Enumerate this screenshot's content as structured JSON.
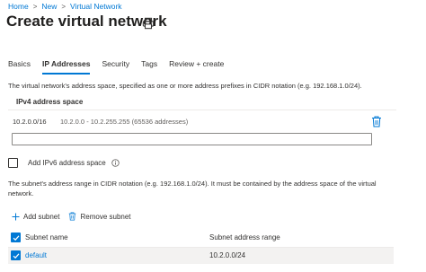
{
  "breadcrumb": {
    "items": [
      "Home",
      "New",
      "Virtual Network"
    ],
    "separator": ">"
  },
  "page": {
    "title": "Create virtual network"
  },
  "tabs": [
    {
      "label": "Basics",
      "active": false
    },
    {
      "label": "IP Addresses",
      "active": true
    },
    {
      "label": "Security",
      "active": false
    },
    {
      "label": "Tags",
      "active": false
    },
    {
      "label": "Review + create",
      "active": false
    }
  ],
  "address_space": {
    "description": "The virtual network's address space, specified as one or more address prefixes in CIDR notation (e.g. 192.168.1.0/24).",
    "header": "IPv4 address space",
    "rows": [
      {
        "prefix": "10.2.0.0/16",
        "range": "10.2.0.0 - 10.2.255.255 (65536 addresses)"
      }
    ],
    "new_input_value": ""
  },
  "ipv6": {
    "label": "Add IPv6 address space",
    "checked": false
  },
  "subnets": {
    "description": "The subnet's address range in CIDR notation (e.g. 192.168.1.0/24). It must be contained by the address space of the virtual network.",
    "add_label": "Add subnet",
    "remove_label": "Remove subnet",
    "columns": [
      "Subnet name",
      "Subnet address range"
    ],
    "rows": [
      {
        "name": "default",
        "range": "10.2.0.0/24",
        "selected": true
      }
    ]
  },
  "colors": {
    "accent": "#0078d4",
    "selected_row_bg": "#f3f2f1"
  },
  "icons": {
    "print": "print-icon",
    "delete": "trash-icon",
    "info": "info-icon",
    "add": "plus-icon",
    "check": "checkmark-icon"
  }
}
